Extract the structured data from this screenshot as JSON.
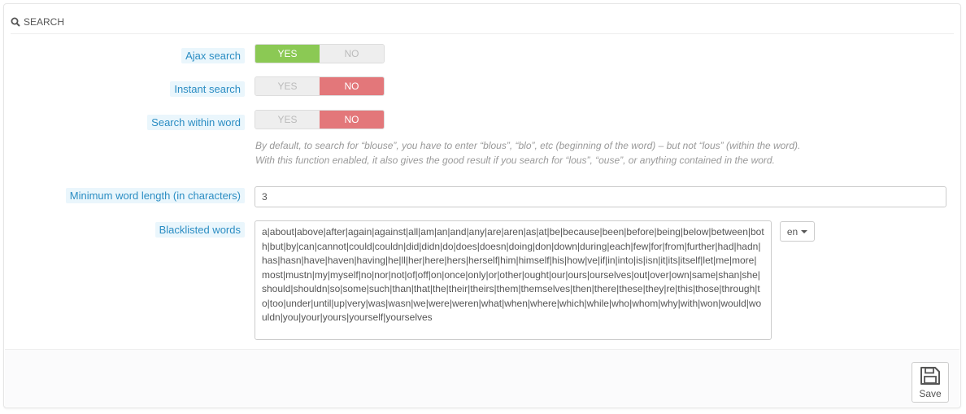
{
  "panel": {
    "title": "Search",
    "icon": "search-icon"
  },
  "fields": {
    "ajax_search": {
      "label": "Ajax search",
      "yes": "YES",
      "no": "NO",
      "value": "YES"
    },
    "instant_search": {
      "label": "Instant search",
      "yes": "YES",
      "no": "NO",
      "value": "NO"
    },
    "search_within_word": {
      "label": "Search within word",
      "yes": "YES",
      "no": "NO",
      "value": "NO",
      "help_line1": "By default, to search for “blouse”, you have to enter “blous”, “blo”, etc (beginning of the word) – but not “lous” (within the word).",
      "help_line2": "With this function enabled, it also gives the good result if you search for “lous”, “ouse”, or anything contained in the word."
    },
    "min_word_length": {
      "label": "Minimum word length (in characters)",
      "value": "3"
    },
    "blacklisted_words": {
      "label": "Blacklisted words",
      "value": "a|about|above|after|again|against|all|am|an|and|any|are|aren|as|at|be|because|been|before|being|below|between|both|but|by|can|cannot|could|couldn|did|didn|do|does|doesn|doing|don|down|during|each|few|for|from|further|had|hadn|has|hasn|have|haven|having|he|ll|her|here|hers|herself|him|himself|his|how|ve|if|in|into|is|isn|it|its|itself|let|me|more|most|mustn|my|myself|no|nor|not|of|off|on|once|only|or|other|ought|our|ours|ourselves|out|over|own|same|shan|she|should|shouldn|so|some|such|than|that|the|their|theirs|them|themselves|then|there|these|they|re|this|those|through|to|too|under|until|up|very|was|wasn|we|were|weren|what|when|where|which|while|who|whom|why|with|won|would|wouldn|you|your|yours|yourself|yourselves",
      "language": "en"
    }
  },
  "footer": {
    "save_label": "Save",
    "save_icon": "floppy-disk-icon"
  },
  "colors": {
    "yes_active": "#8bc954",
    "no_active": "#e3777a",
    "label_bg": "#eaf6fc",
    "label_text": "#2b8dc3"
  }
}
